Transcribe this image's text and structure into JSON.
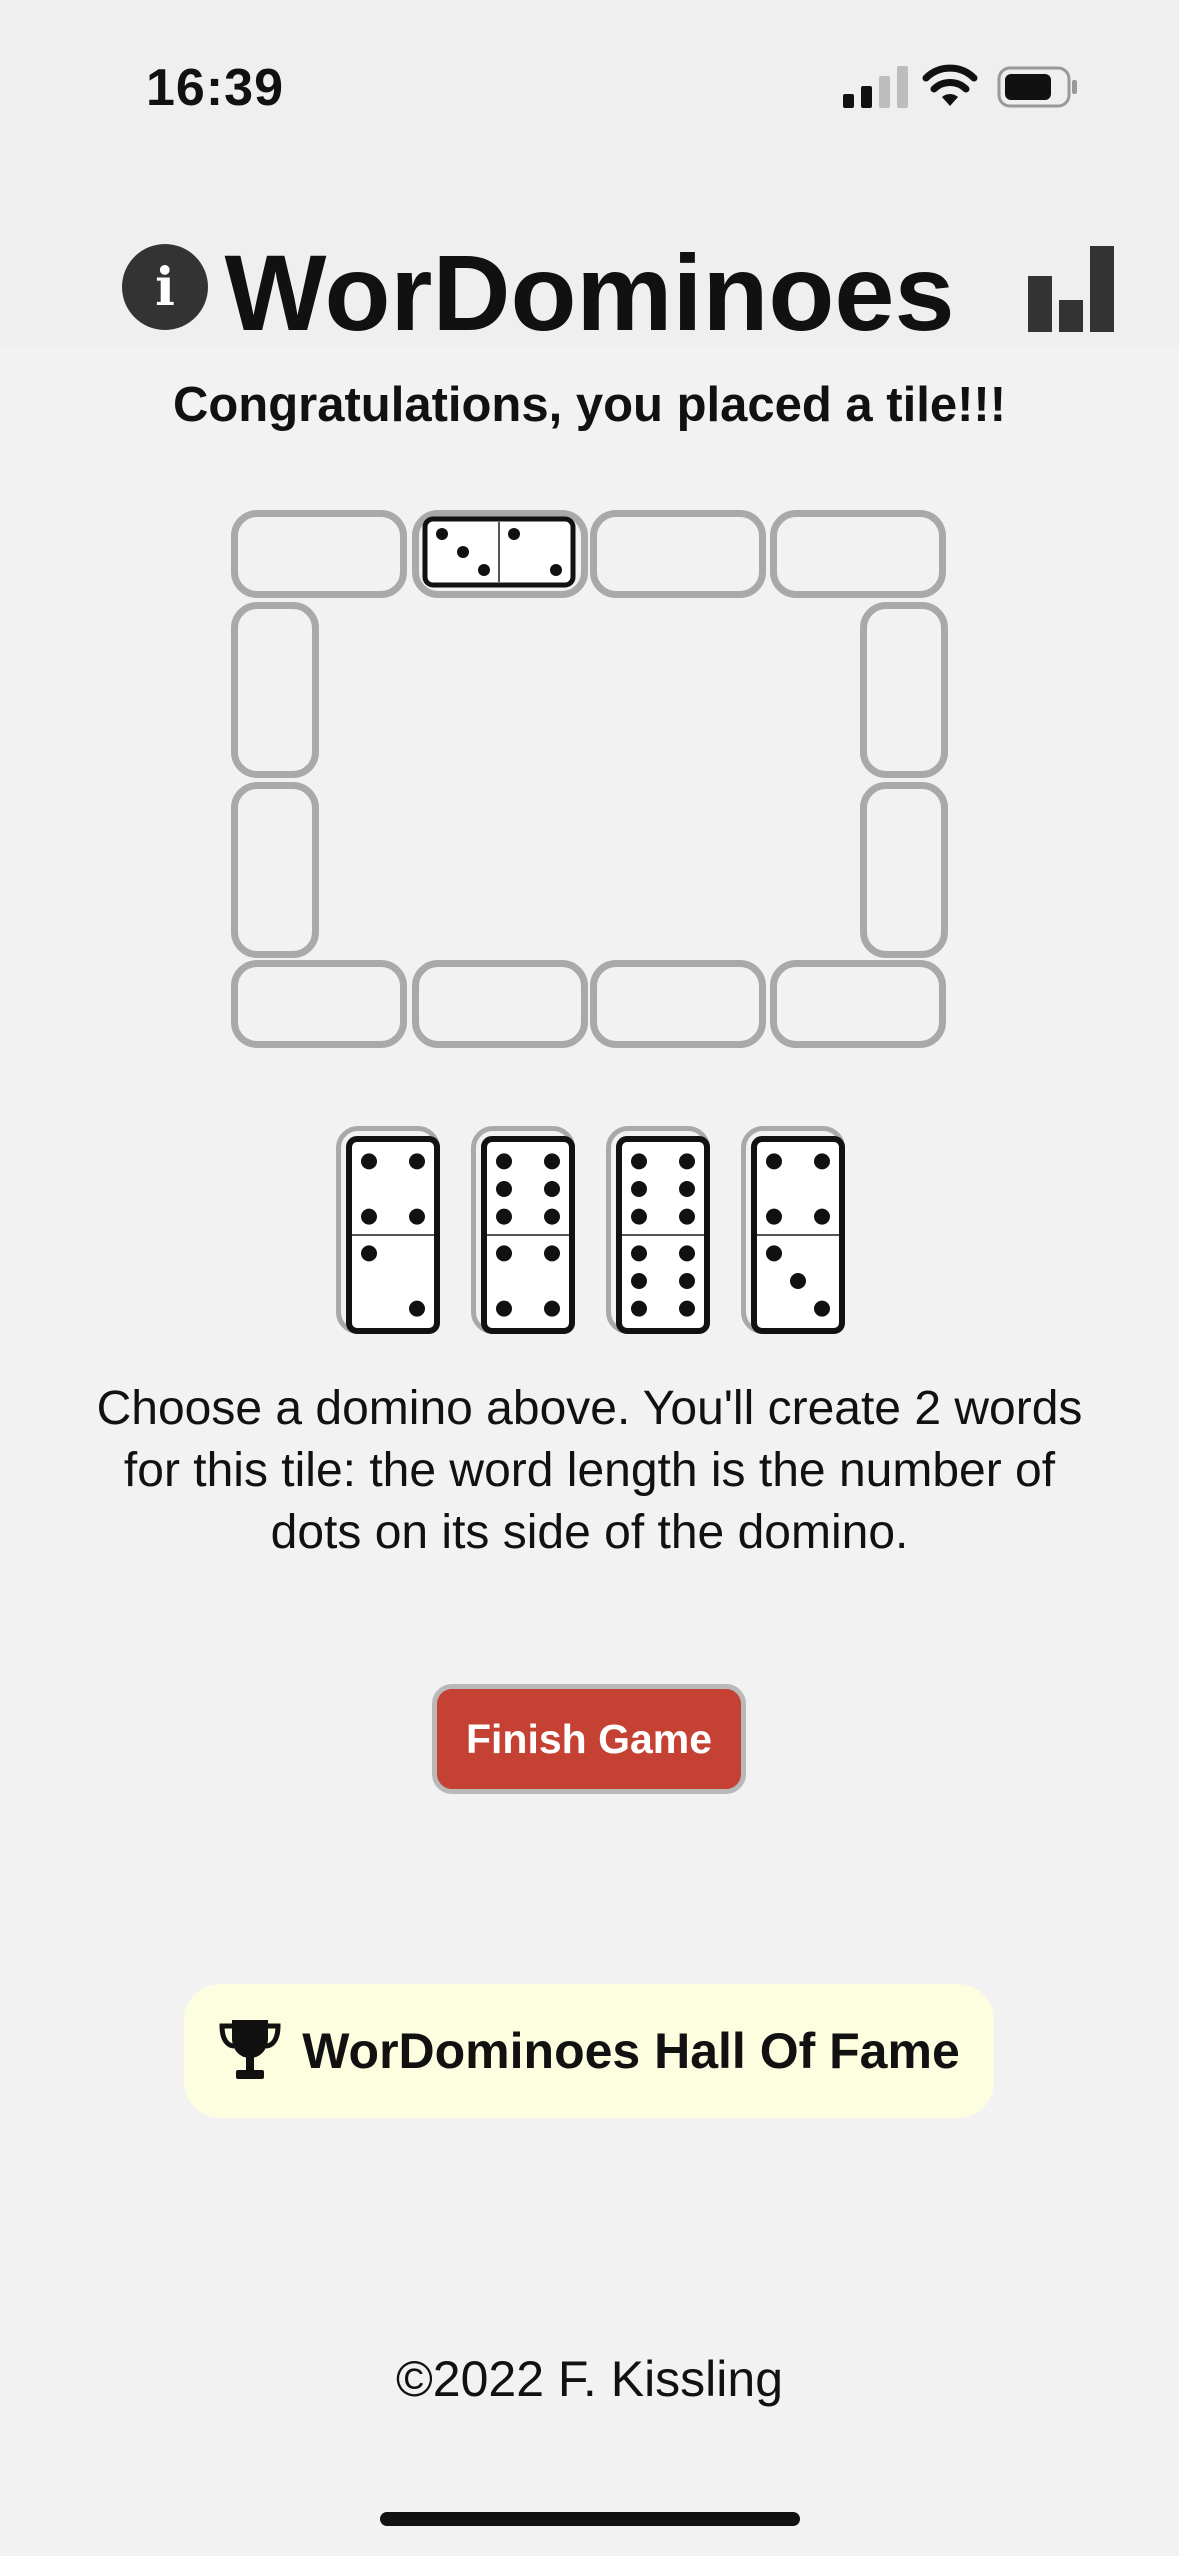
{
  "status_bar": {
    "time": "16:39"
  },
  "header": {
    "title": "WorDominoes",
    "info_icon_glyph": "i",
    "info_icon": "info-icon",
    "stats_icon": "bar-chart-icon"
  },
  "message": "Congratulations, you placed a tile!!!",
  "board": {
    "placed_tile": {
      "left_pips": 3,
      "right_pips": 2
    }
  },
  "hand": [
    {
      "top_pips": 4,
      "bottom_pips": 2
    },
    {
      "top_pips": 6,
      "bottom_pips": 4
    },
    {
      "top_pips": 6,
      "bottom_pips": 6
    },
    {
      "top_pips": 4,
      "bottom_pips": 3
    }
  ],
  "instructions": "Choose a domino above. You'll create 2 words for this tile: the word length is the number of dots on its side of the domino.",
  "finish_button": "Finish Game",
  "hall_of_fame": {
    "label": "WorDominoes Hall Of Fame",
    "icon": "trophy-icon"
  },
  "footer": {
    "copyright": "©2022 F. Kissling"
  },
  "colors": {
    "finish_button": "#c44133",
    "hall_of_fame_bg": "#fdfde0",
    "slot_border": "#a9a9a9",
    "background": "#f2f2f2"
  }
}
